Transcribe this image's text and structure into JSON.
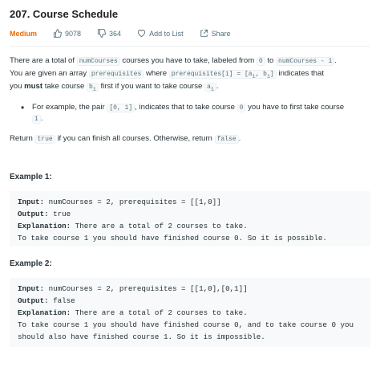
{
  "problem": {
    "title": "207. Course Schedule",
    "difficulty": "Medium",
    "likes": "9078",
    "dislikes": "364",
    "add_to_list": "Add to List",
    "share": "Share",
    "colors": {
      "difficulty": "#ef6c00",
      "text": "#263238",
      "muted": "#546e7a",
      "code_bg": "#f7f9fa"
    },
    "icons": {
      "likes": "thumbs-up-icon",
      "dislikes": "thumbs-down-icon",
      "add_to_list": "heart-icon",
      "share": "share-icon"
    }
  },
  "description": {
    "p1": {
      "t1": "There are a total of ",
      "c1": "numCourses",
      "t2": " courses you have to take, labeled from ",
      "c2": "0",
      "t3": " to ",
      "c3": "numCourses - 1",
      "t4": "."
    },
    "p2": {
      "t1": "You are given an array ",
      "c1": "prerequisites",
      "t2": " where ",
      "c2": "prerequisites[i] = [a",
      "c2_sub1": "i",
      "c2_mid": ", b",
      "c2_sub2": "i",
      "c2_end": "]",
      "t3": " indicates that"
    },
    "p3": {
      "t1": "you ",
      "bold": "must",
      "t2": " take course ",
      "c1": "b",
      "c1_sub": "i",
      "t3": " first if you want to take course ",
      "c2": "a",
      "c2_sub": "i",
      "t4": "."
    },
    "bullet": {
      "t1": "For example, the pair ",
      "c1": "[0, 1]",
      "t2": ", indicates that to take course ",
      "c2": "0",
      "t3": " you have to first take course",
      "c3": "1",
      "t4": "."
    },
    "return": {
      "t1": "Return ",
      "c1": "true",
      "t2": " if you can finish all courses. Otherwise, return ",
      "c2": "false",
      "t3": "."
    }
  },
  "examples": [
    {
      "heading": "Example 1:",
      "input_label": "Input:",
      "input": " numCourses = 2, prerequisites = [[1,0]]",
      "output_label": "Output:",
      "output": " true",
      "explanation_label": "Explanation:",
      "explanation": " There are a total of 2 courses to take.",
      "explanation_line2": "To take course 1 you should have finished course 0. So it is possible."
    },
    {
      "heading": "Example 2:",
      "input_label": "Input:",
      "input": " numCourses = 2, prerequisites = [[1,0],[0,1]]",
      "output_label": "Output:",
      "output": " false",
      "explanation_label": "Explanation:",
      "explanation": " There are a total of 2 courses to take.",
      "explanation_line2": "To take course 1 you should have finished course 0, and to take course 0 you",
      "explanation_line3": "should also have finished course 1. So it is impossible."
    }
  ]
}
